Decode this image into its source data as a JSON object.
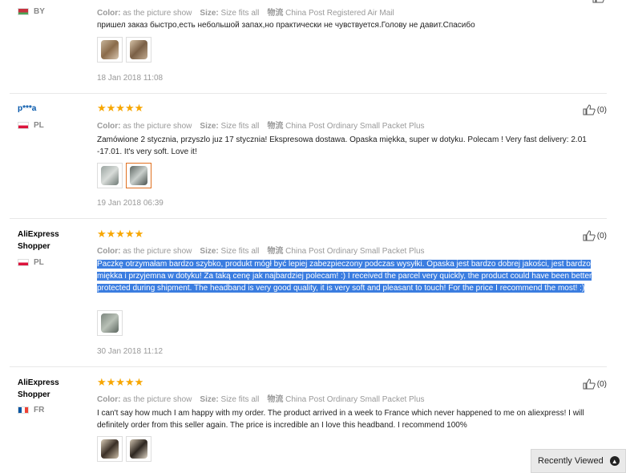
{
  "meta_labels": {
    "color": "Color:",
    "size": "Size:",
    "shipping_icon": "物流"
  },
  "reviews": [
    {
      "user": "",
      "country": "BY",
      "color_value": "as the picture show",
      "size_value": "Size fits all",
      "shipping": "China Post Registered Air Mail",
      "text": "пришел заказ быстро,есть небольшой запах,но практически не чувствуется.Голову не давит.Спасибо",
      "date": "18 Jan 2018 11:08",
      "useful": ""
    },
    {
      "user": "p***a",
      "country": "PL",
      "stars": "★★★★★",
      "color_value": "as the picture show",
      "size_value": "Size fits all",
      "shipping": "China Post Ordinary Small Packet Plus",
      "text": "Zamówione 2 stycznia, przyszlo juz 17 stycznia! Ekspresowa dostawa. Opaska miękka, super w dotyku. Polecam ! Very fast delivery: 2.01 -17.01. It's very soft. Love it!",
      "date": "19 Jan 2018 06:39",
      "useful": "(0)"
    },
    {
      "user_line1": "AliExpress",
      "user_line2": "Shopper",
      "country": "PL",
      "stars": "★★★★★",
      "color_value": "as the picture show",
      "size_value": "Size fits all",
      "shipping": "China Post Ordinary Small Packet Plus",
      "text": "Paczkę otrzymałam bardzo szybko, produkt mógł być lepiej zabezpieczony podczas wysyłki. Opaska jest bardzo dobrej jakości, jest bardzo miękka i przyjemna w dotyku! Za taką cenę jak najbardziej polecam! :) I received the parcel very quickly, the product could have been better protected during shipment. The headband is very good quality, it is very soft and pleasant to touch! For the price I recommend the most! :)",
      "date": "30 Jan 2018 11:12",
      "useful": "(0)"
    },
    {
      "user_line1": "AliExpress",
      "user_line2": "Shopper",
      "country": "FR",
      "stars": "★★★★★",
      "color_value": "as the picture show",
      "size_value": "Size fits all",
      "shipping": "China Post Ordinary Small Packet Plus",
      "text": "I can't say how much I am happy with my order. The product arrived in a week to France which never happened to me on aliexpress! I will definitely order from this seller again. The price is incredible an I love this headband. I recommend 100%",
      "useful": "(0)"
    }
  ],
  "recently_viewed": "Recently Viewed"
}
